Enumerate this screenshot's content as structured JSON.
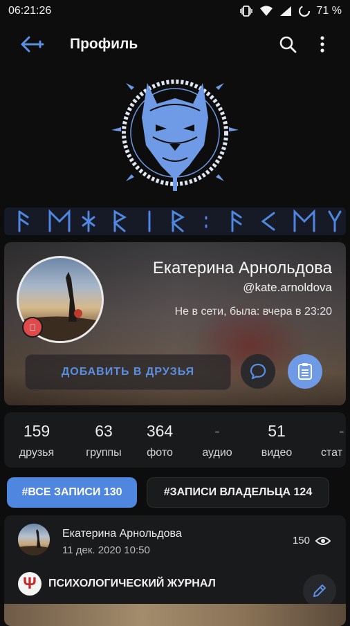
{
  "status_bar": {
    "time": "06:21:26",
    "battery": "71 %"
  },
  "app_bar": {
    "title": "Профиль"
  },
  "profile": {
    "name": "Екатерина Арнольдова",
    "handle": "@kate.arnoldova",
    "status": "Не в сети, была: вчера в 23:20",
    "add_friend_label": "ДОБАВИТЬ В ДРУЗЬЯ"
  },
  "stats": [
    {
      "value": "159",
      "label": "друзья"
    },
    {
      "value": "63",
      "label": "группы"
    },
    {
      "value": "364",
      "label": "фото"
    },
    {
      "value": "-",
      "label": "аудио"
    },
    {
      "value": "51",
      "label": "видео"
    },
    {
      "value": "-",
      "label": "стат"
    }
  ],
  "filters": {
    "all": "#ВСЕ ЗАПИСИ 130",
    "owner": "#ЗАПИСИ ВЛАДЕЛЬЦА 124"
  },
  "post": {
    "author": "Екатерина Арнольдова",
    "date": "11 дек. 2020 10:50",
    "views": "150",
    "source_icon": "Ψ",
    "source": "ПСИХОЛОГИЧЕСКИЙ ЖУРНАЛ"
  },
  "colors": {
    "accent": "#4f86e0",
    "emblem": "#6e9ae6",
    "background": "#0d0d0e"
  },
  "icons": [
    "back-arrow-icon",
    "search-icon",
    "more-vert-icon",
    "apple-icon",
    "message-icon",
    "list-icon",
    "eye-icon",
    "pencil-icon",
    "vibrate-icon",
    "wifi-icon",
    "signal-icon",
    "battery-icon"
  ]
}
